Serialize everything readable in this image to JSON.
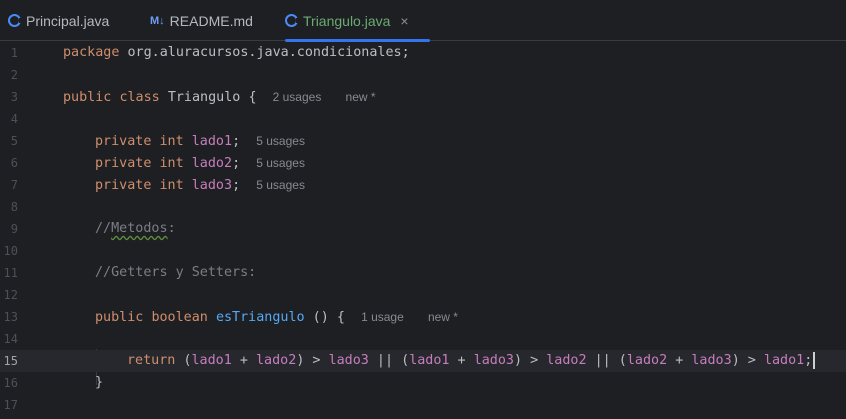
{
  "tabs": [
    {
      "label": "Principal.java",
      "icon": "java-class-icon"
    },
    {
      "label": "README.md",
      "icon": "markdown-icon",
      "icon_text": "M↓"
    },
    {
      "label": "Triangulo.java",
      "icon": "java-class-icon",
      "active": true,
      "close": "×"
    }
  ],
  "lines": [
    {
      "n": "1",
      "package_kw": "package",
      "package_name": " org.aluracursos.java.condicionales;"
    },
    {
      "n": "2"
    },
    {
      "n": "3",
      "kw1": "public",
      "kw2": "class",
      "name": "Triangulo",
      "brace": "{",
      "hint1": "2 usages",
      "hint2": "new *"
    },
    {
      "n": "4"
    },
    {
      "n": "5",
      "kw1": "private",
      "kw2": "int",
      "field": "lado1",
      "semi": ";",
      "hint": "5 usages"
    },
    {
      "n": "6",
      "kw1": "private",
      "kw2": "int",
      "field": "lado2",
      "semi": ";",
      "hint": "5 usages"
    },
    {
      "n": "7",
      "kw1": "private",
      "kw2": "int",
      "field": "lado3",
      "semi": ";",
      "hint": "5 usages"
    },
    {
      "n": "8"
    },
    {
      "n": "9",
      "comment_prefix": "//",
      "comment_word": "Metodos",
      "comment_suffix": ":"
    },
    {
      "n": "10"
    },
    {
      "n": "11",
      "comment": "//Getters y Setters:"
    },
    {
      "n": "12"
    },
    {
      "n": "13",
      "kw1": "public",
      "kw2": "boolean",
      "method": "esTriangulo",
      "sig": " () {",
      "hint1": "1 usage",
      "hint2": "new *"
    },
    {
      "n": "14"
    },
    {
      "n": "15",
      "ret": "return",
      "p1": " (",
      "a1": "lado1",
      "op1": " + ",
      "a2": "lado2",
      "p2": ") > ",
      "a3": "lado3",
      "p3": " || (",
      "a4": "lado1",
      "op2": " + ",
      "a5": "lado3",
      "p4": ") > ",
      "a6": "lado2",
      "p5": " || (",
      "a7": "lado2",
      "op3": " + ",
      "a8": "lado3",
      "p6": ") > ",
      "a9": "lado1",
      "p7": ";"
    },
    {
      "n": "16",
      "brace": "}"
    },
    {
      "n": "17"
    }
  ],
  "colors": {
    "background": "#1e1f22",
    "keyword": "#cf8e6d",
    "field": "#c77dbb",
    "method": "#56a8f5",
    "active_tab": "#6aab73",
    "accent": "#3574f0"
  }
}
